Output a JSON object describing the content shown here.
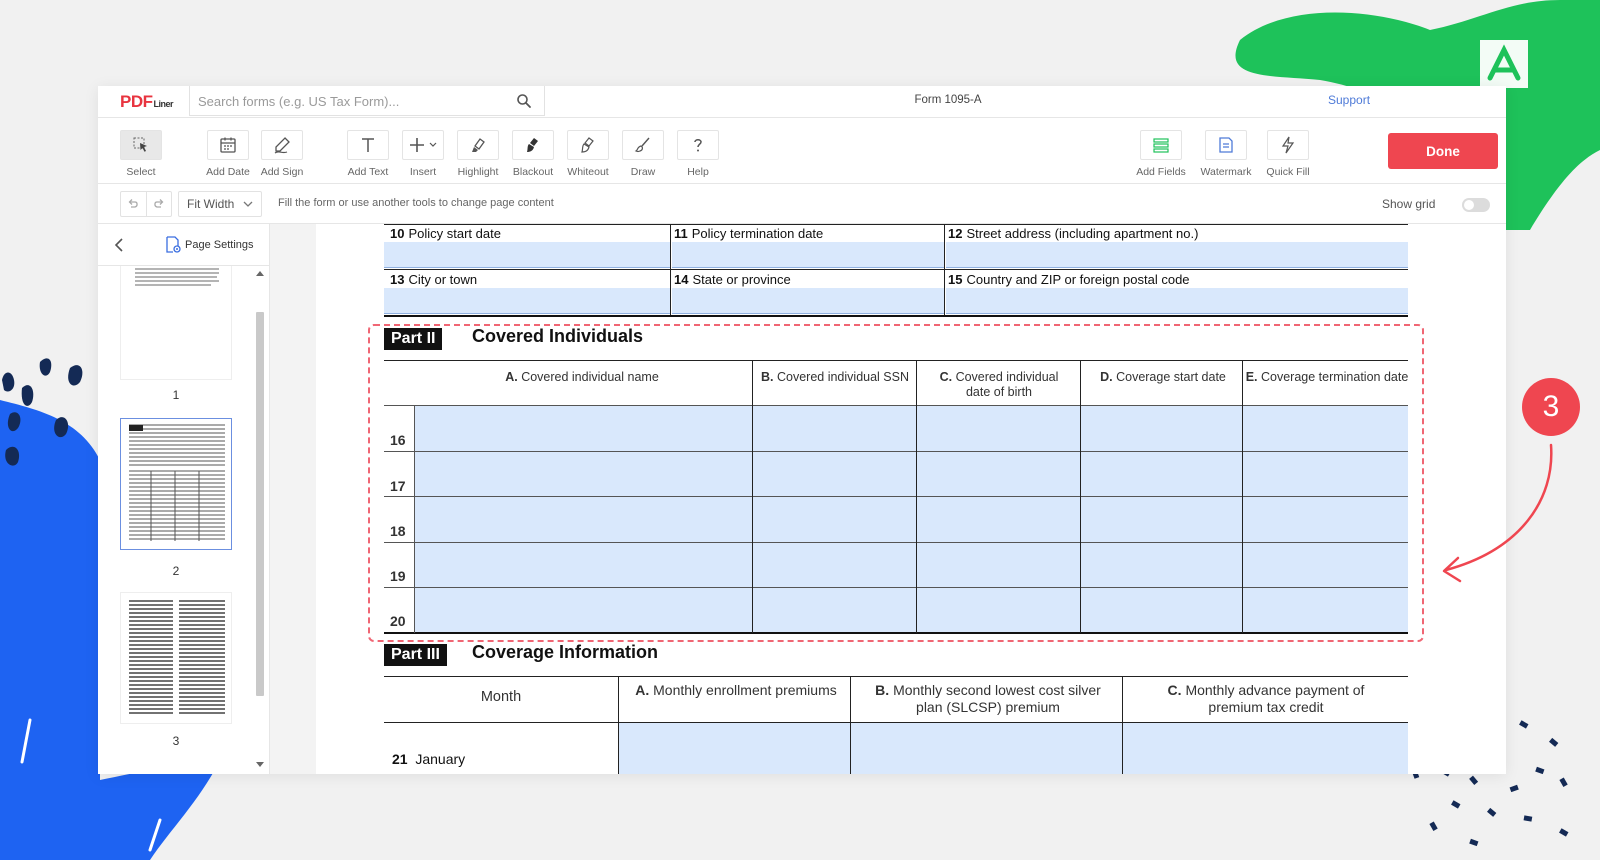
{
  "header": {
    "logo_main": "PDF",
    "logo_sub": "Liner",
    "search_placeholder": "Search forms (e.g. US Tax Form)...",
    "document_title": "Form 1095-A",
    "support_label": "Support"
  },
  "toolbar": {
    "tools": [
      {
        "label": "Select",
        "icon": "select-cursor-icon"
      },
      {
        "label": "Add Date",
        "icon": "calendar-icon"
      },
      {
        "label": "Add Sign",
        "icon": "signature-pen-icon"
      },
      {
        "label": "Add Text",
        "icon": "text-icon"
      },
      {
        "label": "Insert",
        "icon": "plus-icon"
      },
      {
        "label": "Highlight",
        "icon": "highlighter-icon"
      },
      {
        "label": "Blackout",
        "icon": "blackout-brush-icon"
      },
      {
        "label": "Whiteout",
        "icon": "whiteout-brush-icon"
      },
      {
        "label": "Draw",
        "icon": "brush-icon"
      },
      {
        "label": "Help",
        "icon": "question-icon"
      },
      {
        "label": "Add Fields",
        "icon": "fields-icon"
      },
      {
        "label": "Watermark",
        "icon": "watermark-icon"
      },
      {
        "label": "Quick Fill",
        "icon": "lightning-icon"
      }
    ],
    "done_label": "Done"
  },
  "subbar": {
    "zoom_value": "Fit Width",
    "hint": "Fill the form or use another tools to change page content",
    "show_grid_label": "Show grid",
    "show_grid_enabled": false
  },
  "sidebar": {
    "page_settings_label": "Page Settings",
    "pages": [
      "1",
      "2",
      "3"
    ],
    "selected_page": "2"
  },
  "form": {
    "row_top_labels": [
      {
        "num": "10",
        "text": "Policy start date"
      },
      {
        "num": "11",
        "text": "Policy termination date"
      },
      {
        "num": "12",
        "text": "Street address (including apartment no.)"
      }
    ],
    "row_second_labels": [
      {
        "num": "13",
        "text": "City or town"
      },
      {
        "num": "14",
        "text": "State or province"
      },
      {
        "num": "15",
        "text": "Country and ZIP or foreign postal code"
      }
    ],
    "part2": {
      "tag": "Part II",
      "title": "Covered Individuals",
      "columns": [
        {
          "letter": "A.",
          "text": "Covered individual name"
        },
        {
          "letter": "B.",
          "text": "Covered individual SSN"
        },
        {
          "letter": "C.",
          "text": "Covered individual",
          "text2": "date of birth"
        },
        {
          "letter": "D.",
          "text": "Coverage start date"
        },
        {
          "letter": "E.",
          "text": "Coverage termination date"
        }
      ],
      "rows": [
        "16",
        "17",
        "18",
        "19",
        "20"
      ]
    },
    "part3": {
      "tag": "Part III",
      "title": "Coverage Information",
      "month_header": "Month",
      "columns": [
        {
          "letter": "A.",
          "text": "Monthly enrollment premiums"
        },
        {
          "letter": "B.",
          "text": "Monthly second lowest cost silver",
          "text2": "plan (SLCSP) premium"
        },
        {
          "letter": "C.",
          "text": "Monthly advance payment of",
          "text2": "premium tax credit"
        }
      ],
      "first_row": {
        "num": "21",
        "month": "January"
      }
    }
  },
  "callout": {
    "step": "3"
  },
  "colors": {
    "accent_red": "#ef4650",
    "field_blue": "#d9e8fc",
    "link_blue": "#4f7bd8",
    "deco_green": "#1ec25a",
    "deco_blue": "#1e63f2",
    "deco_navy": "#142a55"
  }
}
